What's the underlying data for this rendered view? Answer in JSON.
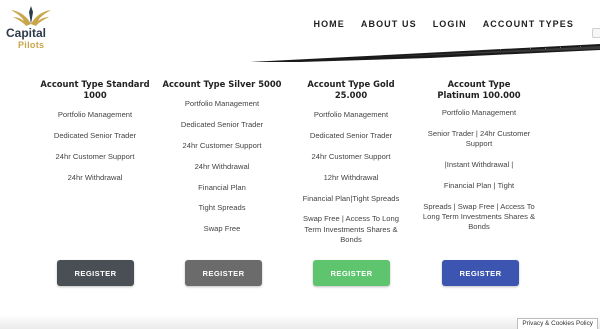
{
  "brand": {
    "name": "Capital",
    "sub": "Pilots",
    "gold": "#c9a64a",
    "navy": "#2d3a4a"
  },
  "nav": [
    "HOME",
    "ABOUT US",
    "LOGIN",
    "ACCOUNT TYPES"
  ],
  "plans": [
    {
      "title": "Account Type Standard 1000",
      "features": [
        "Portfolio Management",
        "Dedicated Senior Trader",
        "24hr Customer Support",
        "24hr Withdrawal"
      ],
      "button": "REGISTER",
      "button_color": "#4a4f56"
    },
    {
      "title": "Account Type Silver 5000",
      "features": [
        "Portfolio Management",
        "Dedicated Senior Trader",
        "24hr Customer Support",
        "24hr Withdrawal",
        "Financial Plan",
        "Tight Spreads",
        "Swap Free"
      ],
      "button": "REGISTER",
      "button_color": "#6b6b6b"
    },
    {
      "title": "Account Type Gold 25.000",
      "features": [
        "Portfolio Management",
        "Dedicated Senior Trader",
        "24hr Customer Support",
        "12hr Withdrawal",
        "Financial Plan|Tight Spreads",
        "Swap Free | Access To Long Term Investments Shares & Bonds"
      ],
      "button": "REGISTER",
      "button_color": "#5ec46e"
    },
    {
      "title": "Account Type Platinum 100.000",
      "features": [
        "Portfolio Management",
        "Senior Trader | 24hr Customer Support",
        "|Instant Withdrawal |",
        "Financial Plan | Tight",
        "Spreads | Swap Free | Access To Long Term Investments Shares & Bonds"
      ],
      "button": "REGISTER",
      "button_color": "#3b55b0"
    }
  ],
  "cookie": "Privacy & Cookies Policy"
}
